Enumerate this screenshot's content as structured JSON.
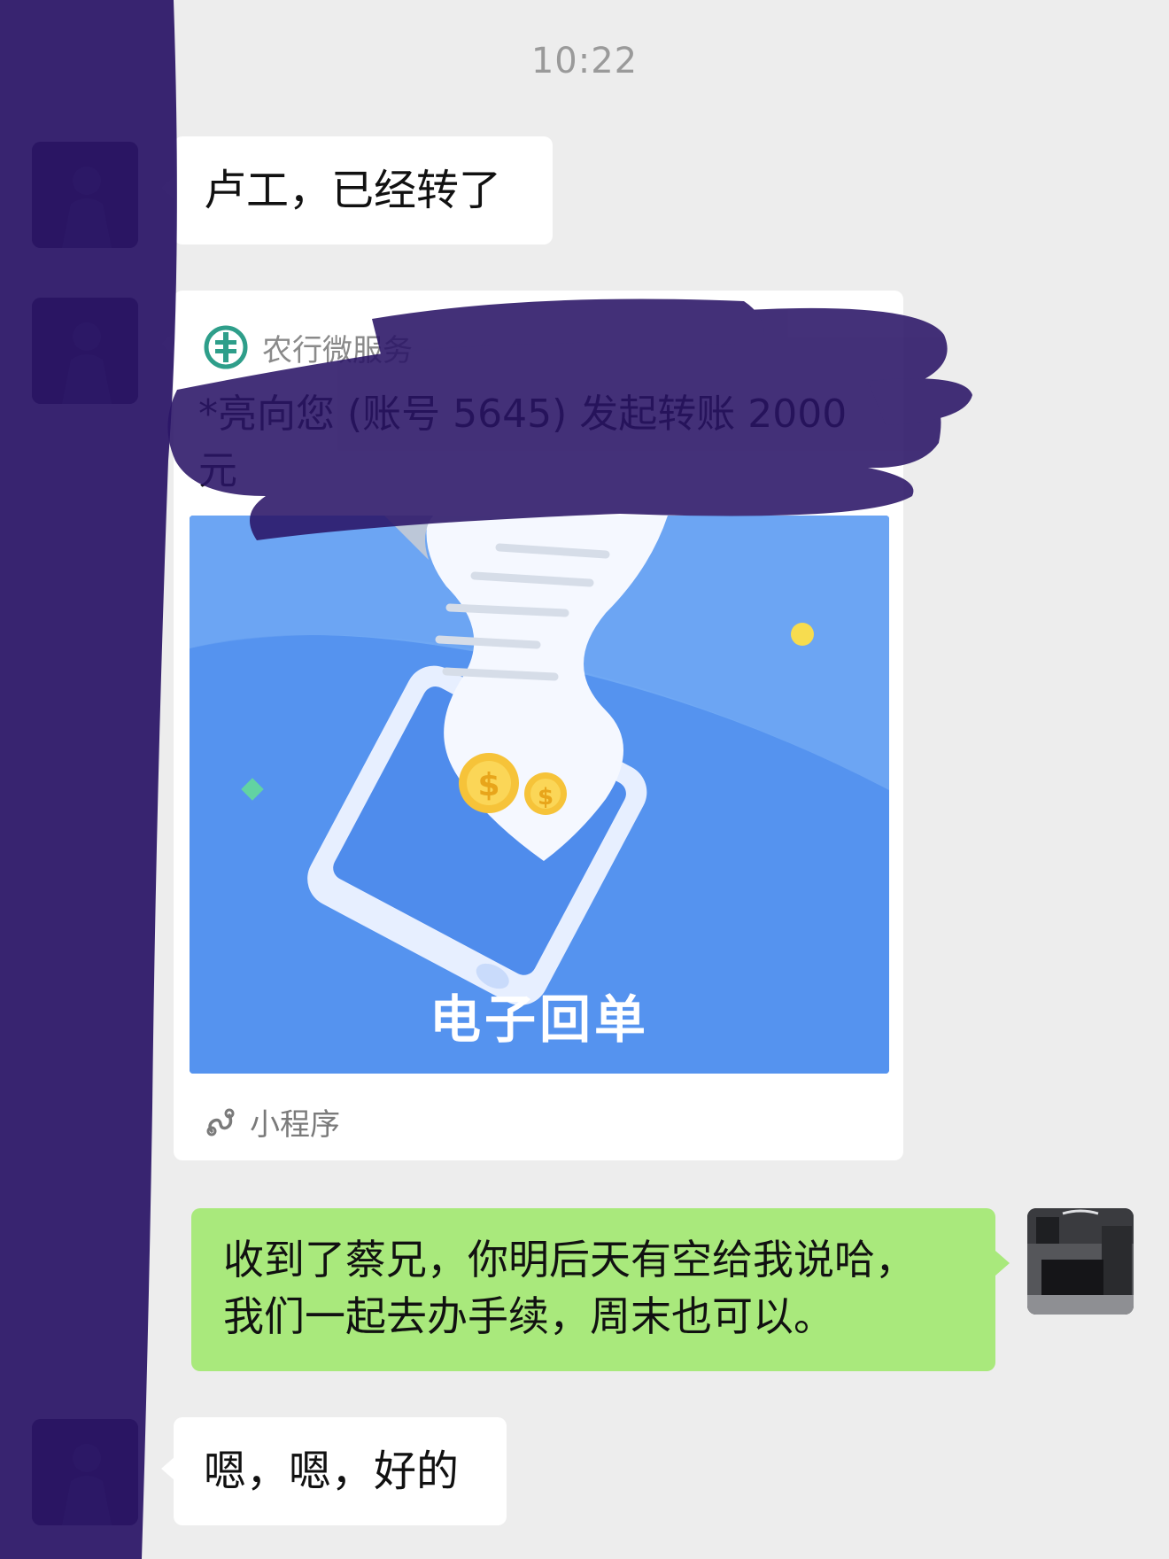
{
  "status": {
    "time": "10:22"
  },
  "messages": [
    {
      "side": "left",
      "text": "卢工，已经转了"
    },
    {
      "side": "left",
      "type": "mini-program-card",
      "source": "农行微服务",
      "title": "*亮向您 (账号 5645) 发起转账 2000元",
      "image_label": "电子回单",
      "footer": "小程序"
    },
    {
      "side": "right",
      "lines": [
        "收到了蔡兄，你明后天有空给我说哈，",
        "我们一起去办手续，周末也可以。"
      ]
    },
    {
      "side": "left",
      "text": "嗯，嗯，好的"
    }
  ],
  "colors": {
    "background": "#ededed",
    "incoming_bubble": "#ffffff",
    "outgoing_bubble": "#a9e97c",
    "card_image_blue": "#5593ef",
    "redaction": "#2a1466",
    "bank_logo": "#2e9e8a"
  },
  "icons": [
    "bank-logo-icon",
    "mini-program-link-icon",
    "coin-dollar-icon"
  ]
}
